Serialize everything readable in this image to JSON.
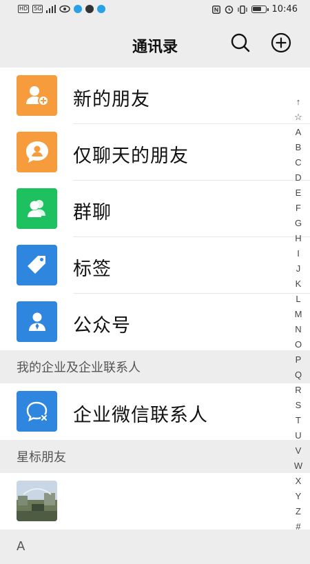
{
  "status_bar": {
    "left_chips": [
      "HD",
      "5G"
    ],
    "time": "10:46"
  },
  "nav": {
    "title": "通讯录",
    "search_icon": "search-icon",
    "add_icon": "plus-circle-icon"
  },
  "menu_items": [
    {
      "label": "新的朋友",
      "icon": "add-friend-icon",
      "color": "#f79c3c"
    },
    {
      "label": "仅聊天的朋友",
      "icon": "chat-only-friend-icon",
      "color": "#f79c3c"
    },
    {
      "label": "群聊",
      "icon": "group-chat-icon",
      "color": "#1ec15f"
    },
    {
      "label": "标签",
      "icon": "tag-icon",
      "color": "#2e86de"
    },
    {
      "label": "公众号",
      "icon": "official-account-icon",
      "color": "#2e86de"
    }
  ],
  "enterprise_section": {
    "header": "我的企业及企业联系人",
    "item_label": "企业微信联系人",
    "item_icon": "wecom-icon",
    "item_color": "#2e86de"
  },
  "starred_section": {
    "header": "星标朋友"
  },
  "alpha_section": {
    "header": "A"
  },
  "index_bar": [
    "↑",
    "☆",
    "A",
    "B",
    "C",
    "D",
    "E",
    "F",
    "G",
    "H",
    "I",
    "J",
    "K",
    "L",
    "M",
    "N",
    "O",
    "P",
    "Q",
    "R",
    "S",
    "T",
    "U",
    "V",
    "W",
    "X",
    "Y",
    "Z",
    "#"
  ]
}
